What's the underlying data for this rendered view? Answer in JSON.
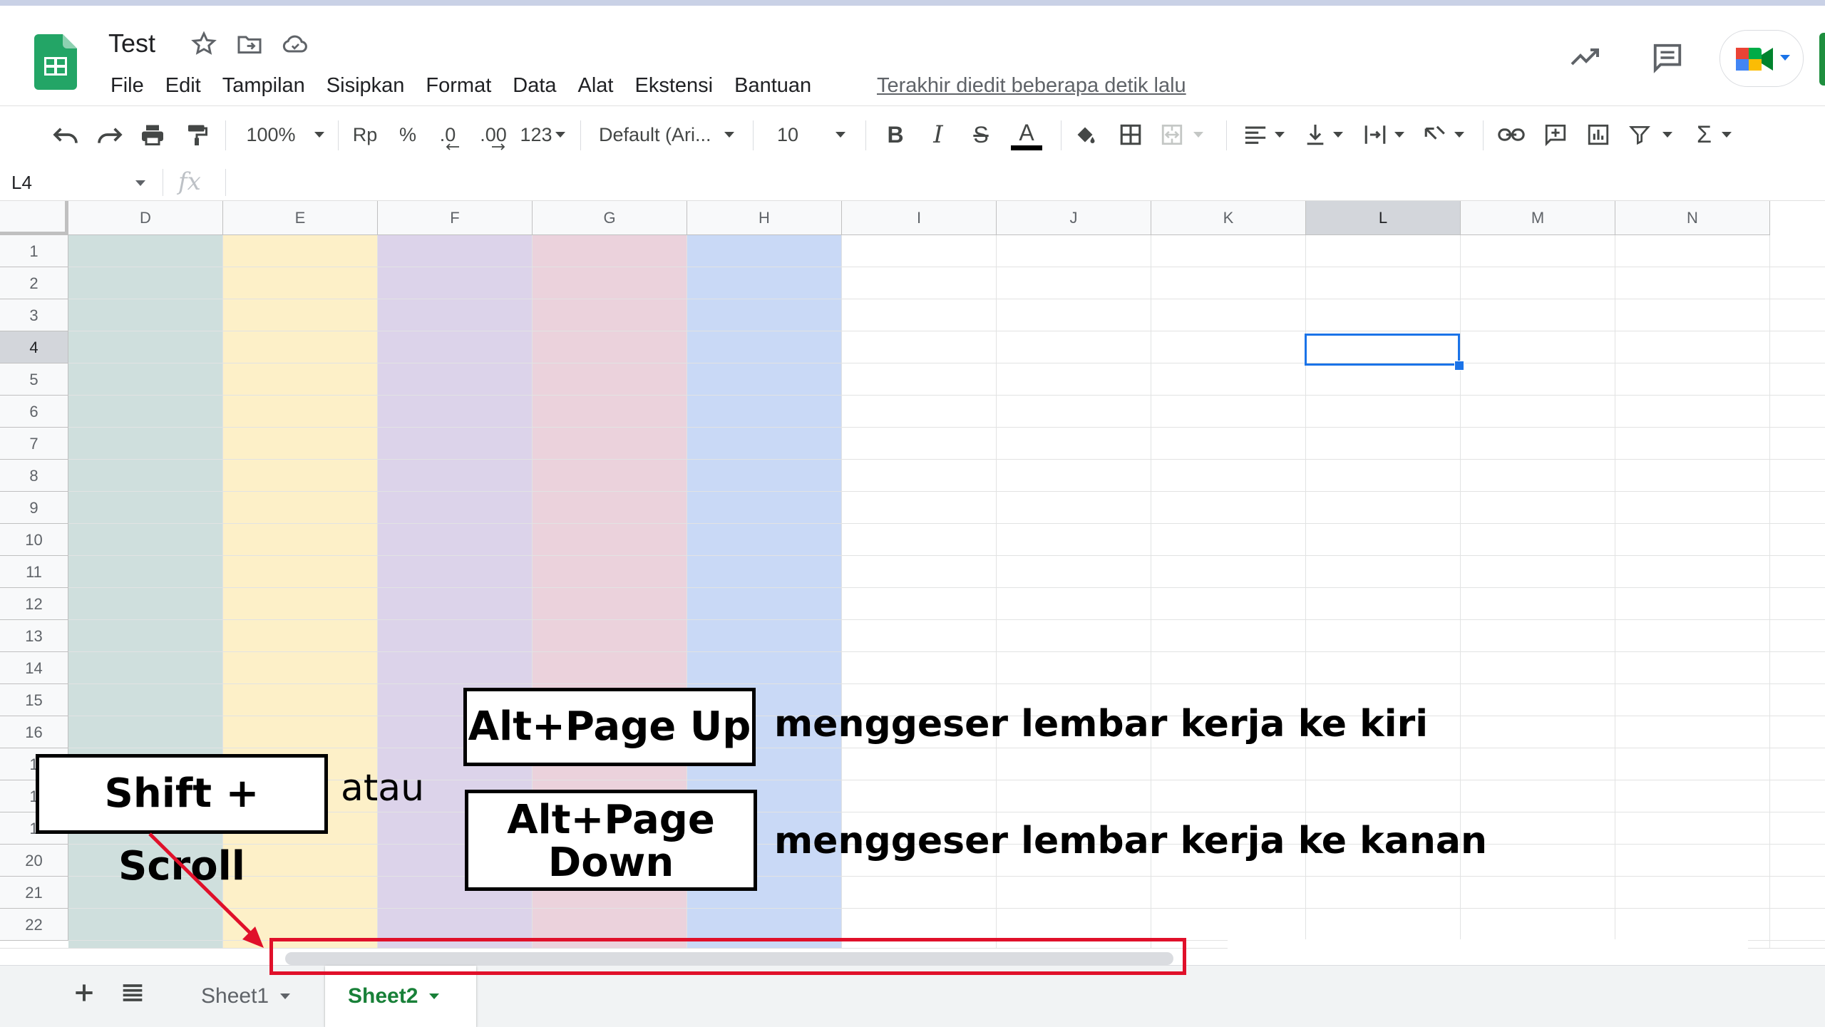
{
  "header": {
    "title": "Test",
    "menu": [
      "File",
      "Edit",
      "Tampilan",
      "Sisipkan",
      "Format",
      "Data",
      "Alat",
      "Ekstensi",
      "Bantuan"
    ],
    "last_edit": "Terakhir diedit beberapa detik lalu"
  },
  "toolbar": {
    "zoom": "100%",
    "currency": "Rp",
    "percent": "%",
    "decrease_decimal": ".0",
    "increase_decimal": ".00",
    "more_formats": "123",
    "font": "Default (Ari...",
    "font_size": "10",
    "bold": "B",
    "italic": "I",
    "strike": "S",
    "text_color": "A",
    "sum": "Σ"
  },
  "formula_bar": {
    "name_box": "L4",
    "fx": "fx"
  },
  "grid": {
    "columns": [
      "D",
      "E",
      "F",
      "G",
      "H",
      "I",
      "J",
      "K",
      "L",
      "M",
      "N"
    ],
    "rows": [
      "1",
      "2",
      "3",
      "4",
      "5",
      "6",
      "7",
      "8",
      "9",
      "10",
      "11",
      "12",
      "13",
      "14",
      "15",
      "16",
      "1",
      "1",
      "1",
      "20",
      "21",
      "22"
    ],
    "selected_column": "L",
    "selected_row": "4",
    "column_colors": {
      "D": "#cfdfdd",
      "E": "#fdf0c8",
      "F": "#dcd3ea",
      "G": "#ebd2dc",
      "H": "#c9d9f6"
    }
  },
  "tabs": {
    "sheets": [
      "Sheet1",
      "Sheet2"
    ],
    "active": "Sheet2"
  },
  "annotations": {
    "alt_page_up": "Alt+Page Up",
    "alt_page_down_1": "Alt+Page",
    "alt_page_down_2": "Down",
    "shift_scroll": "Shift + Scroll",
    "or": "atau",
    "move_left": "menggeser lembar kerja ke kiri",
    "move_right": "menggeser lembar kerja ke kanan",
    "highlight_color": "#e0102a"
  }
}
